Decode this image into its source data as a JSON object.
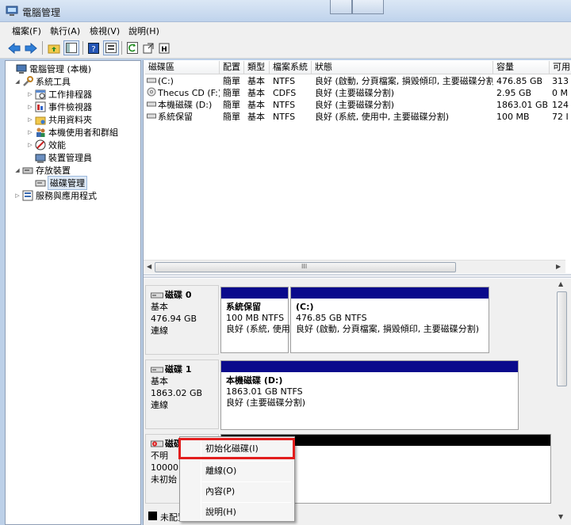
{
  "window": {
    "title": "電腦管理"
  },
  "menu": [
    "檔案(F)",
    "執行(A)",
    "檢視(V)",
    "說明(H)"
  ],
  "toolbar": {
    "buttons": [
      "back-icon",
      "forward-icon",
      "up-folder-icon",
      "show-tree-icon",
      "help-icon",
      "properties-icon",
      "refresh-icon",
      "export-icon",
      "help-book-icon"
    ]
  },
  "tree": {
    "items": [
      {
        "label": "電腦管理 (本機)",
        "icon": "computer-management-icon"
      },
      {
        "label": "系統工具",
        "icon": "tools-icon"
      },
      {
        "label": "工作排程器",
        "icon": "task-scheduler-icon"
      },
      {
        "label": "事件檢視器",
        "icon": "event-viewer-icon"
      },
      {
        "label": "共用資料夾",
        "icon": "shared-folder-icon"
      },
      {
        "label": "本機使用者和群組",
        "icon": "users-icon"
      },
      {
        "label": "效能",
        "icon": "performance-icon"
      },
      {
        "label": "裝置管理員",
        "icon": "device-manager-icon"
      },
      {
        "label": "存放裝置",
        "icon": "storage-icon"
      },
      {
        "label": "磁碟管理",
        "icon": "disk-management-icon"
      },
      {
        "label": "服務與應用程式",
        "icon": "services-icon"
      }
    ]
  },
  "volumes": {
    "columns": [
      "磁碟區",
      "配置",
      "類型",
      "檔案系統",
      "狀態",
      "容量",
      "可用"
    ],
    "rows": [
      {
        "name": "(C:)",
        "layout": "簡單",
        "type": "基本",
        "fs": "NTFS",
        "status": "良好 (啟動, 分頁檔案, 損毀傾印, 主要磁碟分割)",
        "capacity": "476.85 GB",
        "free": "313"
      },
      {
        "name": "Thecus CD (F:)",
        "layout": "簡單",
        "type": "基本",
        "fs": "CDFS",
        "status": "良好 (主要磁碟分割)",
        "capacity": "2.95 GB",
        "free": "0 M"
      },
      {
        "name": "本機磁碟 (D:)",
        "layout": "簡單",
        "type": "基本",
        "fs": "NTFS",
        "status": "良好 (主要磁碟分割)",
        "capacity": "1863.01 GB",
        "free": "124"
      },
      {
        "name": "系統保留",
        "layout": "簡單",
        "type": "基本",
        "fs": "NTFS",
        "status": "良好 (系統, 使用中, 主要磁碟分割)",
        "capacity": "100 MB",
        "free": "72 I"
      }
    ],
    "scroll_glyph": "III"
  },
  "disks": [
    {
      "name": "磁碟 0",
      "type": "基本",
      "size": "476.94 GB",
      "status": "連線",
      "partitions": [
        {
          "name": "系統保留",
          "size": "100 MB NTFS",
          "status": "良好 (系統, 使用"
        },
        {
          "name": "(C:)",
          "size": "476.85 GB NTFS",
          "status": "良好 (啟動, 分頁檔案, 損毀傾印, 主要磁碟分割)"
        }
      ]
    },
    {
      "name": "磁碟 1",
      "type": "基本",
      "size": "1863.02 GB",
      "status": "連線",
      "partitions": [
        {
          "name": "本機磁碟 (D:)",
          "size": "1863.01 GB NTFS",
          "status": "良好 (主要磁碟分割)"
        }
      ]
    },
    {
      "name": "磁碟",
      "type": "不明",
      "size": "10000.",
      "status": "未初始"
    }
  ],
  "legend": {
    "label": "未配置"
  },
  "context_menu": {
    "items": [
      "初始化磁碟(I)",
      "離線(O)",
      "內容(P)",
      "說明(H)"
    ]
  },
  "colors": {
    "partition_bar": "#0a0a8c",
    "unallocated_bar": "#000000",
    "highlight": "#e21d1d"
  }
}
